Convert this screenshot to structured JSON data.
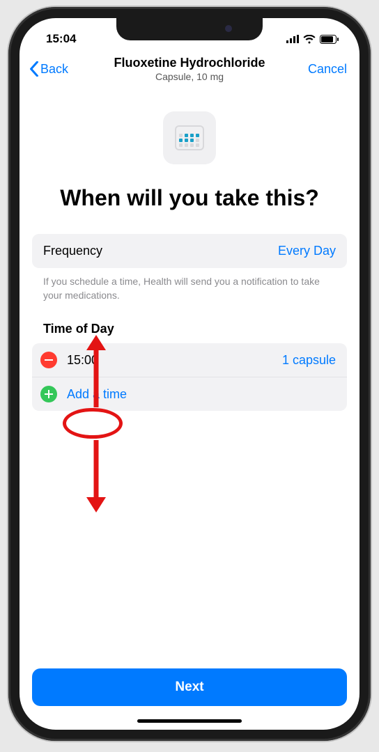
{
  "status": {
    "time": "15:04"
  },
  "nav": {
    "back_label": "Back",
    "title": "Fluoxetine Hydrochloride",
    "subtitle": "Capsule, 10 mg",
    "cancel_label": "Cancel"
  },
  "heading": "When will you take this?",
  "frequency": {
    "label": "Frequency",
    "value": "Every Day"
  },
  "hint": "If you schedule a time, Health will send you a notification to take your medications.",
  "section_label": "Time of Day",
  "times": [
    {
      "time": "15:00",
      "dose": "1 capsule"
    }
  ],
  "add_time_label": "Add a time",
  "next_label": "Next"
}
